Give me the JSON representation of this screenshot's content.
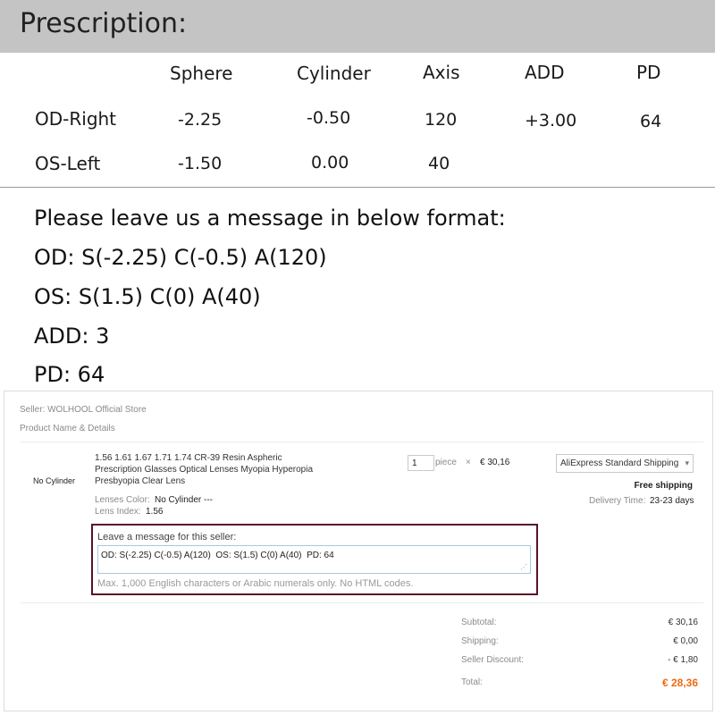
{
  "prescription": {
    "title": "Prescription:",
    "columns": [
      "Sphere",
      "Cylinder",
      "Axis",
      "ADD",
      "PD"
    ],
    "rows": [
      {
        "label": "OD-Right",
        "sphere": "-2.25",
        "cylinder": "-0.50",
        "axis": "120",
        "add": "+3.00",
        "pd": "64"
      },
      {
        "label": "OS-Left",
        "sphere": "-1.50",
        "cylinder": "0.00",
        "axis": "40",
        "add": "",
        "pd": ""
      }
    ]
  },
  "instructions": [
    "Please leave us a message in below format:",
    "OD: S(-2.25) C(-0.5) A(120)",
    "OS: S(1.5) C(0) A(40)",
    "ADD: 3",
    "PD: 64"
  ],
  "order": {
    "seller": "Seller: WOLHOOL Official Store",
    "product_header": "Product Name & Details",
    "variant_tag": "No Cylinder",
    "product_name": "1.56 1.61 1.67 1.71 1.74 CR-39 Resin Aspheric Prescription Glasses Optical Lenses Myopia Hyperopia Presbyopia Clear Lens",
    "lenses_color_label": "Lenses Color:",
    "lenses_color_value": "No Cylinder ---",
    "lens_index_label": "Lens Index:",
    "lens_index_value": "1.56",
    "quantity": "1",
    "unit": "piece",
    "times": "×",
    "unit_price": "€ 30,16",
    "shipping_method": "AliExpress Standard Shipping",
    "free_shipping": "Free shipping",
    "delivery_label": "Delivery Time:",
    "delivery_value": "23-23 days",
    "message_label": "Leave a message for this seller:",
    "message_value": "OD: S(-2.25) C(-0.5) A(120)  OS: S(1.5) C(0) A(40)  PD: 64",
    "message_hint": "Max. 1,000 English characters or Arabic numerals only. No HTML codes.",
    "summary": [
      {
        "label": "Subtotal:",
        "value": "€ 30,16"
      },
      {
        "label": "Shipping:",
        "value": "€ 0,00"
      },
      {
        "label": "Seller Discount:",
        "value": "- € 1,80"
      },
      {
        "label": "Total:",
        "value": "€ 28,36"
      }
    ]
  },
  "colors": {
    "header_bg": "#c4c4c4",
    "message_border": "#5a1226",
    "total_accent": "#f06a0f"
  }
}
